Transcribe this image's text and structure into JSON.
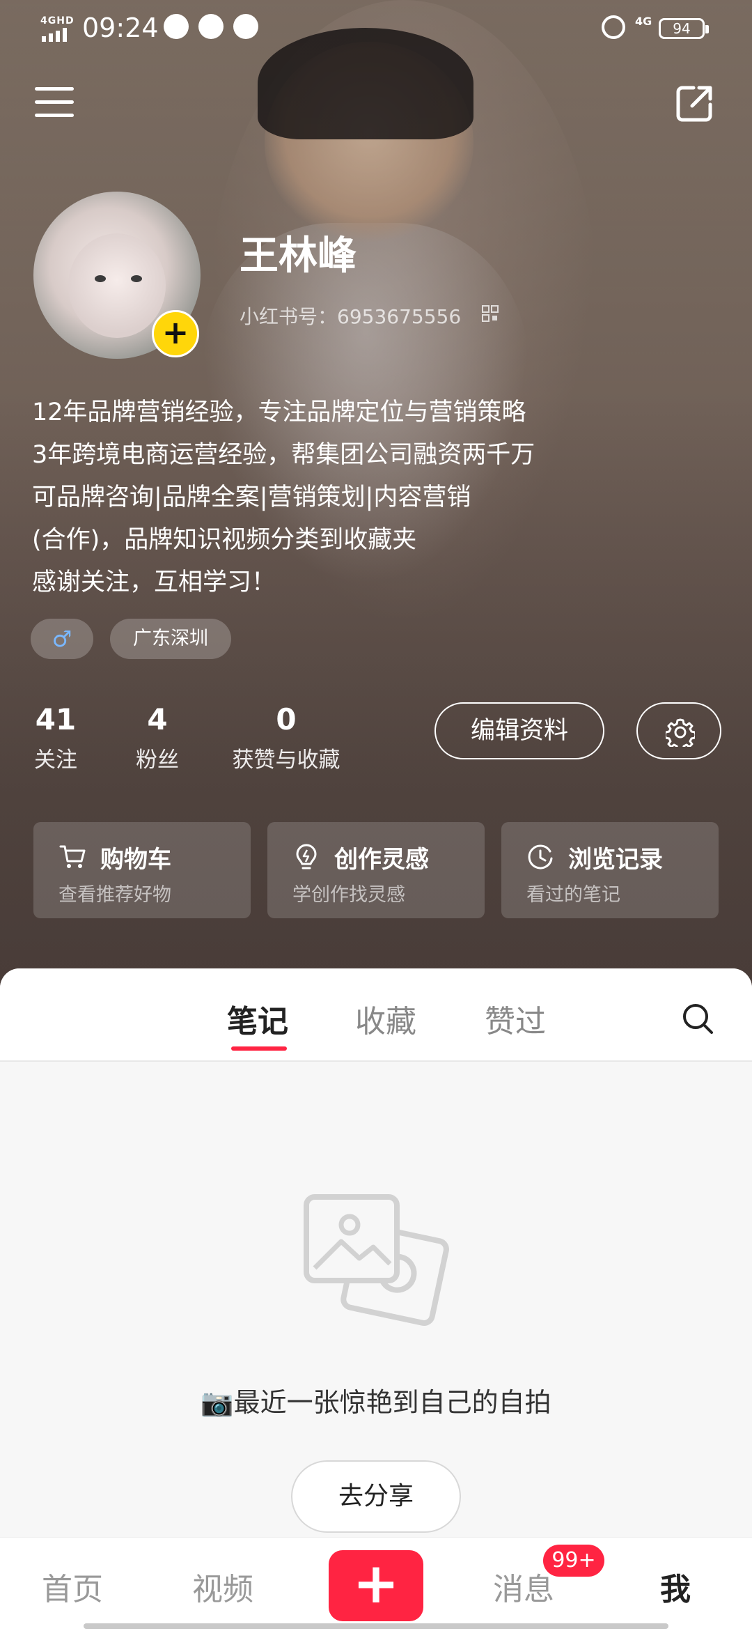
{
  "status_bar": {
    "network": "4GHD",
    "time": "09:24",
    "net_right": "4G",
    "battery": "94"
  },
  "profile": {
    "name": "王林峰",
    "redbook_id": "小红书号：6953675556",
    "bio_lines": [
      "12年品牌营销经验，专注品牌定位与营销策略",
      "3年跨境电商运营经验，帮集团公司融资两千万",
      "可品牌咨询|品牌全案|营销策划|内容营销",
      "(合作)，品牌知识视频分类到收藏夹",
      "感谢关注，互相学习！"
    ],
    "gender_icon": "male-symbol",
    "gender_symbol": "♂",
    "location": "广东深圳"
  },
  "stats": [
    {
      "value": "41",
      "label": "关注"
    },
    {
      "value": "4",
      "label": "粉丝"
    },
    {
      "value": "0",
      "label": "获赞与收藏"
    }
  ],
  "actions": {
    "edit_profile": "编辑资料",
    "settings_icon": "gear-icon"
  },
  "cards": [
    {
      "icon": "cart-icon",
      "title": "购物车",
      "subtitle": "查看推荐好物"
    },
    {
      "icon": "bulb-icon",
      "title": "创作灵感",
      "subtitle": "学创作找灵感"
    },
    {
      "icon": "clock-icon",
      "title": "浏览记录",
      "subtitle": "看过的笔记"
    }
  ],
  "tabs": [
    {
      "label": "笔记",
      "active": true
    },
    {
      "label": "收藏",
      "active": false
    },
    {
      "label": "赞过",
      "active": false
    }
  ],
  "empty_state": {
    "text": "📷最近一张惊艳到自己的自拍",
    "button": "去分享"
  },
  "bottom_nav": {
    "home": "首页",
    "video": "视频",
    "add": "+",
    "messages": "消息",
    "messages_badge": "99+",
    "me": "我"
  },
  "colors": {
    "accent": "#ff2442",
    "avatar_add": "#ffd60a"
  }
}
